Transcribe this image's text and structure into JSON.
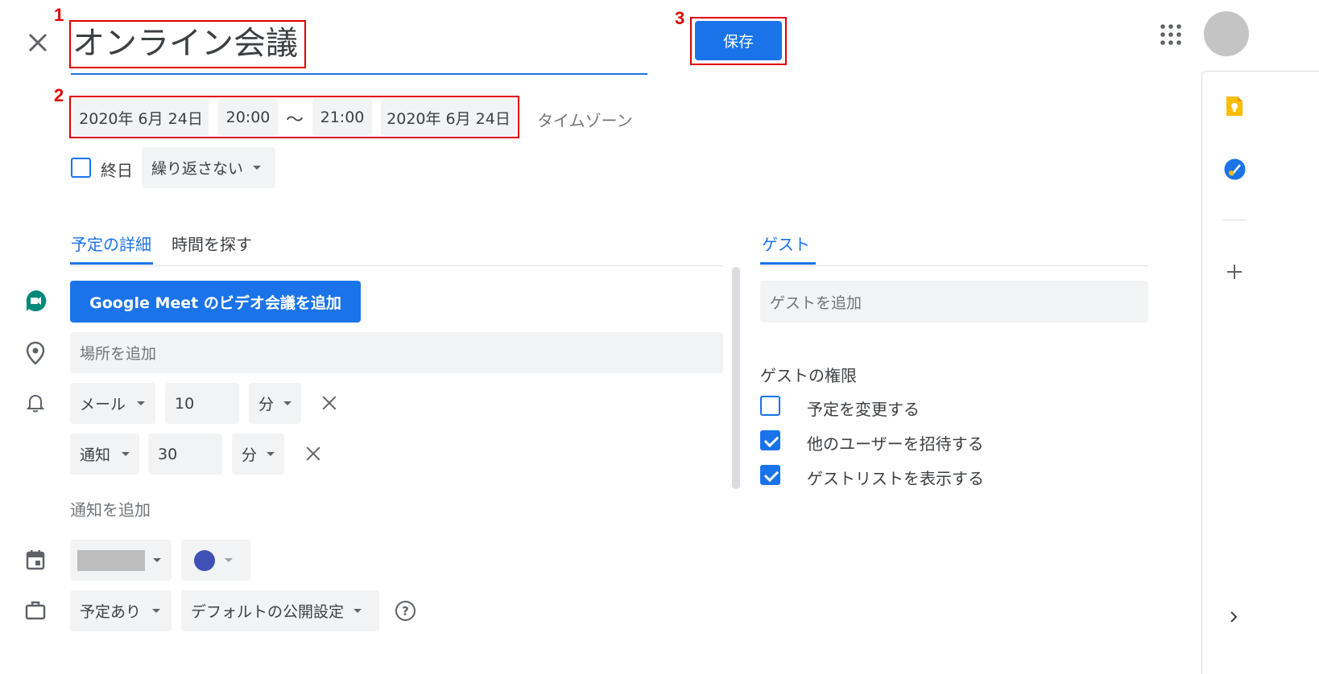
{
  "header": {
    "close_label": "×",
    "event_title": "オンライン会議",
    "save_label": "保存"
  },
  "markers": {
    "m1": "1",
    "m2": "2",
    "m3": "3"
  },
  "datetime": {
    "start_date": "2020年 6月 24日",
    "start_time": "20:00",
    "separator": "〜",
    "end_time": "21:00",
    "end_date": "2020年 6月 24日",
    "timezone_label": "タイムゾーン"
  },
  "allday": {
    "label": "終日",
    "checked": false
  },
  "repeat": {
    "selected": "繰り返さない"
  },
  "tabs": {
    "details": "予定の詳細",
    "find_time": "時間を探す",
    "guests": "ゲスト"
  },
  "meet": {
    "button_label": "Google Meet のビデオ会議を追加"
  },
  "location": {
    "placeholder": "場所を追加"
  },
  "notifications": [
    {
      "type": "メール",
      "value": "10",
      "unit": "分"
    },
    {
      "type": "通知",
      "value": "30",
      "unit": "分"
    }
  ],
  "add_notification_label": "通知を追加",
  "calendar": {
    "event_color": "#3f51b5"
  },
  "status": {
    "busy": "予定あり",
    "visibility": "デフォルトの公開設定",
    "help_icon": "?"
  },
  "guests": {
    "add_placeholder": "ゲストを追加",
    "permissions_title": "ゲストの権限",
    "permissions": [
      {
        "label": "予定を変更する",
        "checked": false
      },
      {
        "label": "他のユーザーを招待する",
        "checked": true
      },
      {
        "label": "ゲストリストを表示する",
        "checked": true
      }
    ]
  },
  "colors": {
    "accent": "#1a73e8",
    "highlight": "#e00000"
  },
  "side_panel": {
    "icons": [
      "keep-icon",
      "tasks-icon",
      "add-icon",
      "chevron-right-icon"
    ]
  }
}
